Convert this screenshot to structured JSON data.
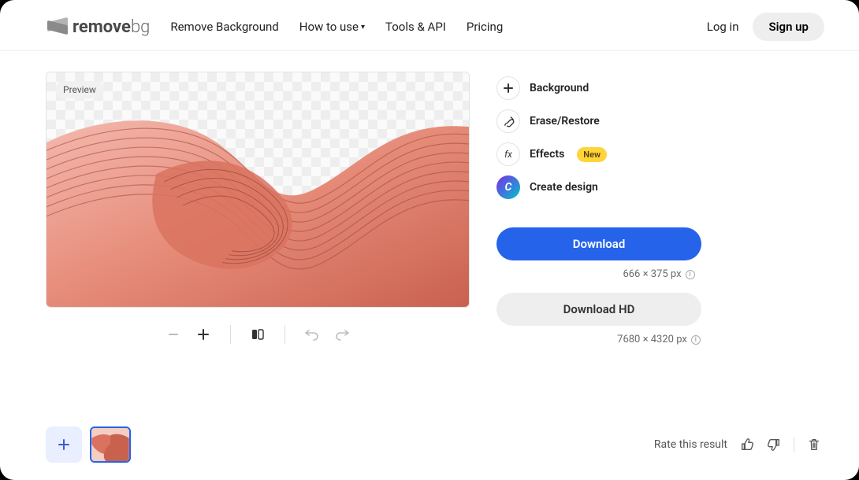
{
  "logo": {
    "brand_bold": "remove",
    "brand_light": "bg"
  },
  "nav": {
    "remove_bg": "Remove Background",
    "how_to": "How to use",
    "tools_api": "Tools & API",
    "pricing": "Pricing"
  },
  "auth": {
    "login": "Log in",
    "signup": "Sign up"
  },
  "preview": {
    "label": "Preview"
  },
  "tools": {
    "background": "Background",
    "erase_restore": "Erase/Restore",
    "effects": "Effects",
    "effects_badge": "New",
    "create_design": "Create design",
    "canva_glyph": "C"
  },
  "downloads": {
    "download": "Download",
    "download_meta": "666 × 375 px",
    "download_hd": "Download HD",
    "download_hd_meta": "7680 × 4320 px"
  },
  "footer": {
    "rate_label": "Rate this result"
  },
  "fx_glyph": "fx"
}
